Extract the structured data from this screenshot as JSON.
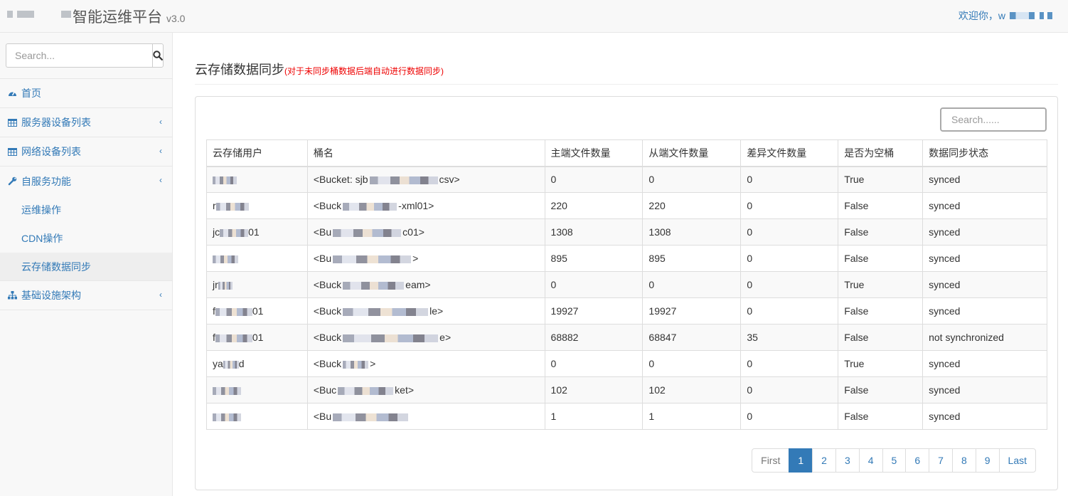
{
  "app": {
    "title_suffix": "智能运维平台",
    "version": "v3.0",
    "welcome": "欢迎你，w"
  },
  "sidebar": {
    "search_placeholder": "Search...",
    "items": [
      {
        "label": "首页",
        "icon": "dashboard-icon"
      },
      {
        "label": "服务器设备列表",
        "icon": "table-icon"
      },
      {
        "label": "网络设备列表",
        "icon": "table-icon"
      },
      {
        "label": "自服务功能",
        "icon": "wrench-icon"
      },
      {
        "label": "基础设施架构",
        "icon": "sitemap-icon"
      }
    ],
    "sub_items": [
      {
        "label": "运维操作"
      },
      {
        "label": "CDN操作"
      },
      {
        "label": "云存储数据同步"
      }
    ]
  },
  "page": {
    "title": "云存储数据同步",
    "hint": "(对于未同步桶数据后端自动进行数据同步)",
    "table_search_placeholder": "Search......"
  },
  "table": {
    "headers": [
      "云存储用户",
      "桶名",
      "主端文件数量",
      "从端文件数量",
      "差异文件数量",
      "是否为空桶",
      "数据同步状态"
    ],
    "rows": [
      {
        "user": "",
        "bucket_pre": "<Bucket: sjb",
        "bucket_post": "csv>",
        "master": "0",
        "slave": "0",
        "diff": "0",
        "empty": "True",
        "status": "synced"
      },
      {
        "user": "r",
        "bucket_pre": "<Buck",
        "bucket_post": "-xml01>",
        "master": "220",
        "slave": "220",
        "diff": "0",
        "empty": "False",
        "status": "synced"
      },
      {
        "user": "jc",
        "user_post": "01",
        "bucket_pre": "<Bu",
        "bucket_post": "c01>",
        "master": "1308",
        "slave": "1308",
        "diff": "0",
        "empty": "False",
        "status": "synced"
      },
      {
        "user": "",
        "bucket_pre": "<Bu",
        "bucket_post": ">",
        "master": "895",
        "slave": "895",
        "diff": "0",
        "empty": "False",
        "status": "synced"
      },
      {
        "user": "jr",
        "bucket_pre": "<Buck",
        "bucket_post": "eam>",
        "master": "0",
        "slave": "0",
        "diff": "0",
        "empty": "True",
        "status": "synced"
      },
      {
        "user": "f",
        "user_post": "01",
        "bucket_pre": "<Buck",
        "bucket_post": "le>",
        "master": "19927",
        "slave": "19927",
        "diff": "0",
        "empty": "False",
        "status": "synced"
      },
      {
        "user": "f",
        "user_post": "01",
        "bucket_pre": "<Buck",
        "bucket_post": "e>",
        "master": "68882",
        "slave": "68847",
        "diff": "35",
        "empty": "False",
        "status": "not synchronized"
      },
      {
        "user": "ya",
        "user_post": "d",
        "bucket_pre": "<Buck",
        "bucket_post": ">",
        "master": "0",
        "slave": "0",
        "diff": "0",
        "empty": "True",
        "status": "synced"
      },
      {
        "user": "",
        "bucket_pre": "<Buc",
        "bucket_post": "ket>",
        "master": "102",
        "slave": "102",
        "diff": "0",
        "empty": "False",
        "status": "synced"
      },
      {
        "user": "",
        "bucket_pre": "<Bu",
        "bucket_post": "",
        "master": "1",
        "slave": "1",
        "diff": "0",
        "empty": "False",
        "status": "synced"
      }
    ]
  },
  "pagination": {
    "first": "First",
    "pages": [
      "1",
      "2",
      "3",
      "4",
      "5",
      "6",
      "7",
      "8",
      "9"
    ],
    "last": "Last",
    "active": "1"
  },
  "colors": {
    "link": "#337ab7",
    "hint": "#ee0000",
    "sidebar_bg": "#f8f8f8"
  }
}
